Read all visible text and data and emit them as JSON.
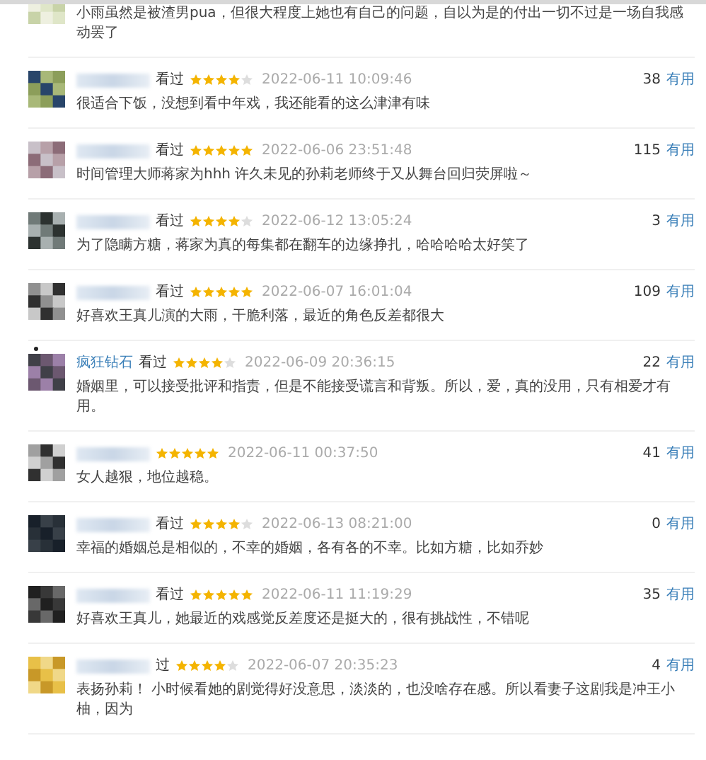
{
  "reviews": [
    {
      "comment": "小雨虽然是被渣男pua，但很大程度上她也有自己的问题，自以为是的付出一切不过是一场自我感动罢了"
    },
    {
      "status": "看过",
      "stars": 4,
      "time": "2022-06-11 10:09:46",
      "votes": "38",
      "vote_label": "有用",
      "comment": "很适合下饭，没想到看中年戏，我还能看的这么津津有味"
    },
    {
      "status": "看过",
      "stars": 5,
      "time": "2022-06-06 23:51:48",
      "votes": "115",
      "vote_label": "有用",
      "comment": "时间管理大师蒋家为hhh 许久未见的孙莉老师终于又从舞台回归荧屏啦～"
    },
    {
      "status": "看过",
      "stars": 4,
      "time": "2022-06-12 13:05:24",
      "votes": "3",
      "vote_label": "有用",
      "comment": "为了隐瞒方糖，蒋家为真的每集都在翻车的边缘挣扎，哈哈哈哈太好笑了"
    },
    {
      "status": "看过",
      "stars": 5,
      "time": "2022-06-07 16:01:04",
      "votes": "109",
      "vote_label": "有用",
      "comment": "好喜欢王真儿演的大雨，干脆利落，最近的角色反差都很大"
    },
    {
      "user": "疯狂钻石",
      "status": "看过",
      "stars": 4,
      "time": "2022-06-09 20:36:15",
      "votes": "22",
      "vote_label": "有用",
      "comment": "婚姻里，可以接受批评和指责，但是不能接受谎言和背叛。所以，爱，真的没用，只有相爱才有用。"
    },
    {
      "stars": 5,
      "time": "2022-06-11 00:37:50",
      "votes": "41",
      "vote_label": "有用",
      "comment": "女人越狠，地位越稳。"
    },
    {
      "status": "看过",
      "stars": 4,
      "time": "2022-06-13 08:21:00",
      "votes": "0",
      "vote_label": "有用",
      "comment": "幸福的婚姻总是相似的，不幸的婚姻，各有各的不幸。比如方糖，比如乔妙"
    },
    {
      "status": "看过",
      "stars": 5,
      "time": "2022-06-11 11:19:29",
      "votes": "35",
      "vote_label": "有用",
      "comment": "好喜欢王真儿，她最近的戏感觉反差度还是挺大的，很有挑战性，不错呢"
    },
    {
      "status": "过",
      "stars": 4,
      "time": "2022-06-07 20:35:23",
      "votes": "4",
      "vote_label": "有用",
      "comment": "表扬孙莉！ 小时候看她的剧觉得好没意思，淡淡的，也没啥存在感。所以看妻子这剧我是冲王小柚，因为"
    }
  ]
}
